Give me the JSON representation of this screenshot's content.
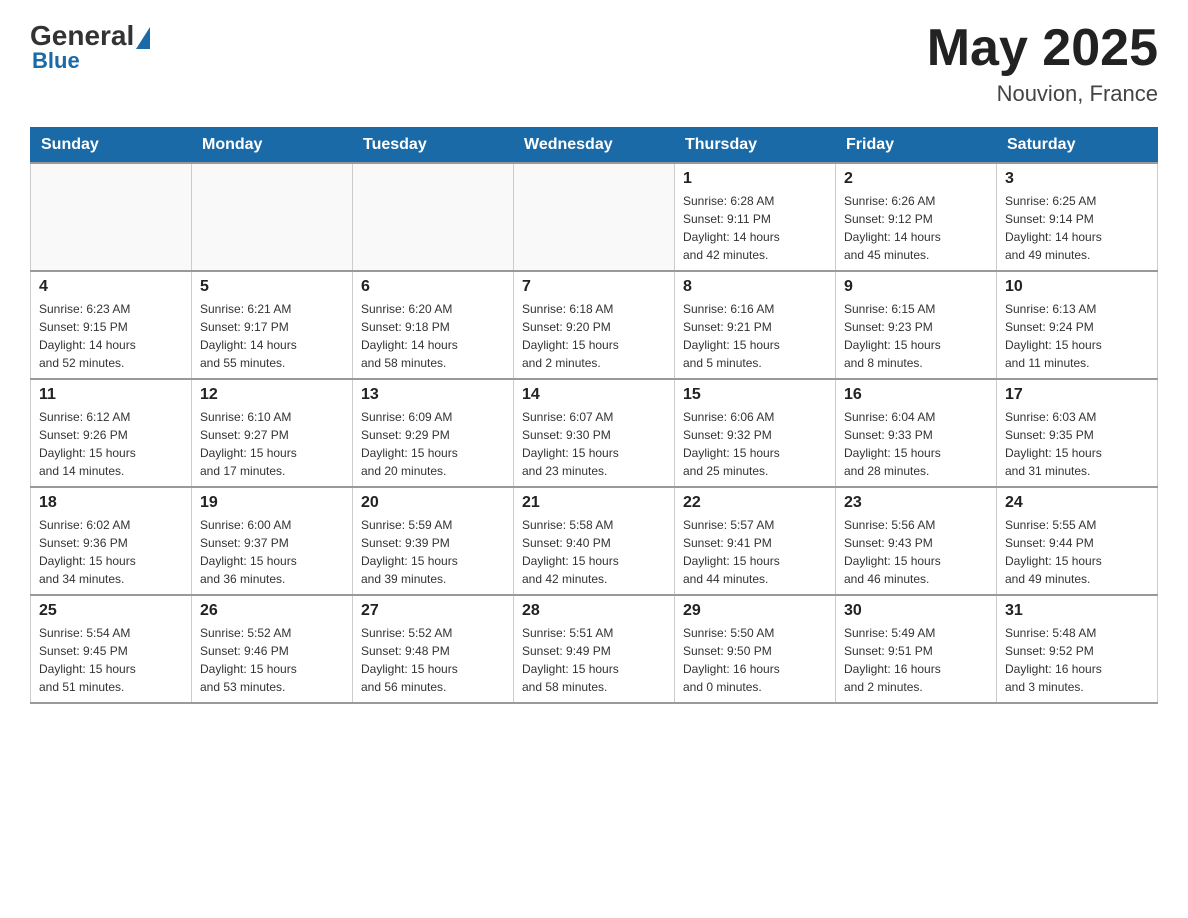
{
  "header": {
    "logo": {
      "general": "General",
      "blue": "Blue"
    },
    "title": "May 2025",
    "location": "Nouvion, France"
  },
  "calendar": {
    "days_of_week": [
      "Sunday",
      "Monday",
      "Tuesday",
      "Wednesday",
      "Thursday",
      "Friday",
      "Saturday"
    ],
    "weeks": [
      {
        "cells": [
          {
            "day": "",
            "info": ""
          },
          {
            "day": "",
            "info": ""
          },
          {
            "day": "",
            "info": ""
          },
          {
            "day": "",
            "info": ""
          },
          {
            "day": "1",
            "info": "Sunrise: 6:28 AM\nSunset: 9:11 PM\nDaylight: 14 hours\nand 42 minutes."
          },
          {
            "day": "2",
            "info": "Sunrise: 6:26 AM\nSunset: 9:12 PM\nDaylight: 14 hours\nand 45 minutes."
          },
          {
            "day": "3",
            "info": "Sunrise: 6:25 AM\nSunset: 9:14 PM\nDaylight: 14 hours\nand 49 minutes."
          }
        ]
      },
      {
        "cells": [
          {
            "day": "4",
            "info": "Sunrise: 6:23 AM\nSunset: 9:15 PM\nDaylight: 14 hours\nand 52 minutes."
          },
          {
            "day": "5",
            "info": "Sunrise: 6:21 AM\nSunset: 9:17 PM\nDaylight: 14 hours\nand 55 minutes."
          },
          {
            "day": "6",
            "info": "Sunrise: 6:20 AM\nSunset: 9:18 PM\nDaylight: 14 hours\nand 58 minutes."
          },
          {
            "day": "7",
            "info": "Sunrise: 6:18 AM\nSunset: 9:20 PM\nDaylight: 15 hours\nand 2 minutes."
          },
          {
            "day": "8",
            "info": "Sunrise: 6:16 AM\nSunset: 9:21 PM\nDaylight: 15 hours\nand 5 minutes."
          },
          {
            "day": "9",
            "info": "Sunrise: 6:15 AM\nSunset: 9:23 PM\nDaylight: 15 hours\nand 8 minutes."
          },
          {
            "day": "10",
            "info": "Sunrise: 6:13 AM\nSunset: 9:24 PM\nDaylight: 15 hours\nand 11 minutes."
          }
        ]
      },
      {
        "cells": [
          {
            "day": "11",
            "info": "Sunrise: 6:12 AM\nSunset: 9:26 PM\nDaylight: 15 hours\nand 14 minutes."
          },
          {
            "day": "12",
            "info": "Sunrise: 6:10 AM\nSunset: 9:27 PM\nDaylight: 15 hours\nand 17 minutes."
          },
          {
            "day": "13",
            "info": "Sunrise: 6:09 AM\nSunset: 9:29 PM\nDaylight: 15 hours\nand 20 minutes."
          },
          {
            "day": "14",
            "info": "Sunrise: 6:07 AM\nSunset: 9:30 PM\nDaylight: 15 hours\nand 23 minutes."
          },
          {
            "day": "15",
            "info": "Sunrise: 6:06 AM\nSunset: 9:32 PM\nDaylight: 15 hours\nand 25 minutes."
          },
          {
            "day": "16",
            "info": "Sunrise: 6:04 AM\nSunset: 9:33 PM\nDaylight: 15 hours\nand 28 minutes."
          },
          {
            "day": "17",
            "info": "Sunrise: 6:03 AM\nSunset: 9:35 PM\nDaylight: 15 hours\nand 31 minutes."
          }
        ]
      },
      {
        "cells": [
          {
            "day": "18",
            "info": "Sunrise: 6:02 AM\nSunset: 9:36 PM\nDaylight: 15 hours\nand 34 minutes."
          },
          {
            "day": "19",
            "info": "Sunrise: 6:00 AM\nSunset: 9:37 PM\nDaylight: 15 hours\nand 36 minutes."
          },
          {
            "day": "20",
            "info": "Sunrise: 5:59 AM\nSunset: 9:39 PM\nDaylight: 15 hours\nand 39 minutes."
          },
          {
            "day": "21",
            "info": "Sunrise: 5:58 AM\nSunset: 9:40 PM\nDaylight: 15 hours\nand 42 minutes."
          },
          {
            "day": "22",
            "info": "Sunrise: 5:57 AM\nSunset: 9:41 PM\nDaylight: 15 hours\nand 44 minutes."
          },
          {
            "day": "23",
            "info": "Sunrise: 5:56 AM\nSunset: 9:43 PM\nDaylight: 15 hours\nand 46 minutes."
          },
          {
            "day": "24",
            "info": "Sunrise: 5:55 AM\nSunset: 9:44 PM\nDaylight: 15 hours\nand 49 minutes."
          }
        ]
      },
      {
        "cells": [
          {
            "day": "25",
            "info": "Sunrise: 5:54 AM\nSunset: 9:45 PM\nDaylight: 15 hours\nand 51 minutes."
          },
          {
            "day": "26",
            "info": "Sunrise: 5:52 AM\nSunset: 9:46 PM\nDaylight: 15 hours\nand 53 minutes."
          },
          {
            "day": "27",
            "info": "Sunrise: 5:52 AM\nSunset: 9:48 PM\nDaylight: 15 hours\nand 56 minutes."
          },
          {
            "day": "28",
            "info": "Sunrise: 5:51 AM\nSunset: 9:49 PM\nDaylight: 15 hours\nand 58 minutes."
          },
          {
            "day": "29",
            "info": "Sunrise: 5:50 AM\nSunset: 9:50 PM\nDaylight: 16 hours\nand 0 minutes."
          },
          {
            "day": "30",
            "info": "Sunrise: 5:49 AM\nSunset: 9:51 PM\nDaylight: 16 hours\nand 2 minutes."
          },
          {
            "day": "31",
            "info": "Sunrise: 5:48 AM\nSunset: 9:52 PM\nDaylight: 16 hours\nand 3 minutes."
          }
        ]
      }
    ]
  }
}
